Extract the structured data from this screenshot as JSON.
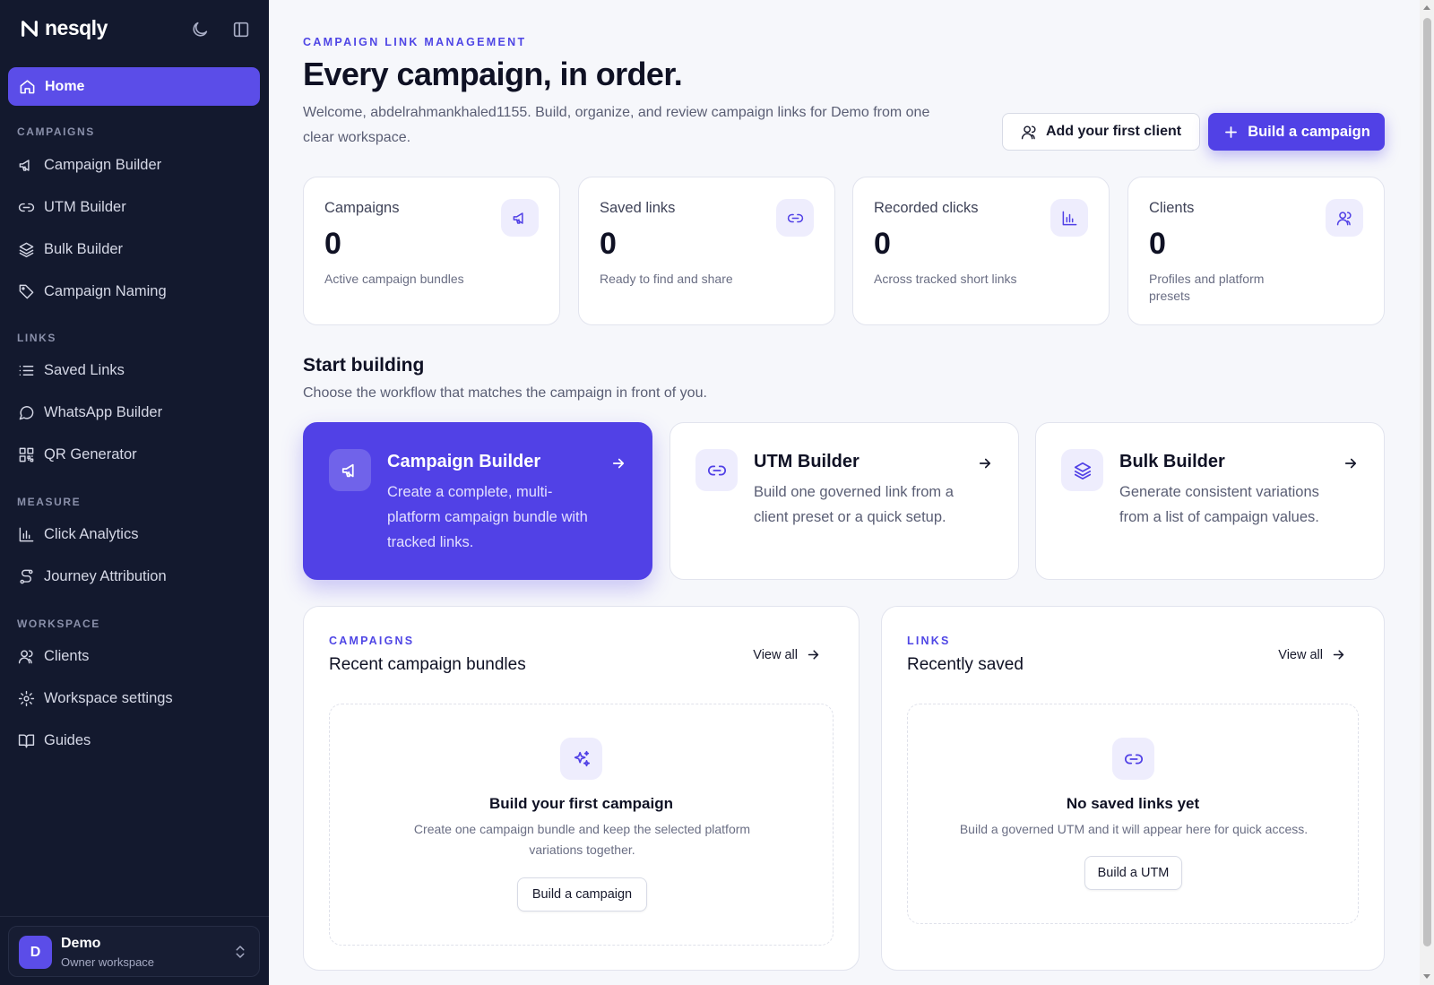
{
  "brand": {
    "name": "nesqly"
  },
  "sidebar": {
    "home_label": "Home",
    "sections": [
      {
        "title": "CAMPAIGNS",
        "items": [
          {
            "label": "Campaign Builder",
            "icon": "megaphone-icon"
          },
          {
            "label": "UTM Builder",
            "icon": "link-icon"
          },
          {
            "label": "Bulk Builder",
            "icon": "layers-icon"
          },
          {
            "label": "Campaign Naming",
            "icon": "tag-icon"
          }
        ]
      },
      {
        "title": "LINKS",
        "items": [
          {
            "label": "Saved Links",
            "icon": "list-icon"
          },
          {
            "label": "WhatsApp Builder",
            "icon": "chat-icon"
          },
          {
            "label": "QR Generator",
            "icon": "qr-icon"
          }
        ]
      },
      {
        "title": "MEASURE",
        "items": [
          {
            "label": "Click Analytics",
            "icon": "bar-chart-icon"
          },
          {
            "label": "Journey Attribution",
            "icon": "route-icon"
          }
        ]
      },
      {
        "title": "WORKSPACE",
        "items": [
          {
            "label": "Clients",
            "icon": "users-icon"
          },
          {
            "label": "Workspace settings",
            "icon": "gear-icon"
          },
          {
            "label": "Guides",
            "icon": "book-icon"
          }
        ]
      }
    ],
    "workspace": {
      "avatar_letter": "D",
      "name": "Demo",
      "role": "Owner workspace"
    }
  },
  "header": {
    "eyebrow": "CAMPAIGN LINK MANAGEMENT",
    "title": "Every campaign, in order.",
    "subtitle": "Welcome, abdelrahmankhaled1155. Build, organize, and review campaign links for Demo from one clear workspace.",
    "add_client_label": "Add your first client",
    "build_campaign_label": "Build a campaign"
  },
  "stats": [
    {
      "label": "Campaigns",
      "value": "0",
      "desc": "Active campaign bundles",
      "icon": "megaphone-icon"
    },
    {
      "label": "Saved links",
      "value": "0",
      "desc": "Ready to find and share",
      "icon": "link-icon"
    },
    {
      "label": "Recorded clicks",
      "value": "0",
      "desc": "Across tracked short links",
      "icon": "bar-chart-icon"
    },
    {
      "label": "Clients",
      "value": "0",
      "desc": "Profiles and platform presets",
      "icon": "users-icon"
    }
  ],
  "start": {
    "title": "Start building",
    "subtitle": "Choose the workflow that matches the campaign in front of you.",
    "flows": [
      {
        "title": "Campaign Builder",
        "desc": "Create a complete, multi-platform campaign bundle with tracked links.",
        "icon": "megaphone-icon",
        "active": true
      },
      {
        "title": "UTM Builder",
        "desc": "Build one governed link from a client preset or a quick setup.",
        "icon": "link-icon",
        "active": false
      },
      {
        "title": "Bulk Builder",
        "desc": "Generate consistent variations from a list of campaign values.",
        "icon": "layers-icon",
        "active": false
      }
    ]
  },
  "panels": {
    "campaigns": {
      "eyebrow": "CAMPAIGNS",
      "title": "Recent campaign bundles",
      "view_all": "View all",
      "empty_title": "Build your first campaign",
      "empty_text": "Create one campaign bundle and keep the selected platform variations together.",
      "empty_button": "Build a campaign",
      "icon": "sparkles-icon"
    },
    "links": {
      "eyebrow": "LINKS",
      "title": "Recently saved",
      "view_all": "View all",
      "empty_title": "No saved links yet",
      "empty_text": "Build a governed UTM and it will appear here for quick access.",
      "empty_button": "Build a UTM",
      "icon": "link-icon"
    }
  },
  "colors": {
    "accent": "#5141e6",
    "sidebar_bg": "#13192e",
    "page_bg": "#f6f7fb"
  }
}
